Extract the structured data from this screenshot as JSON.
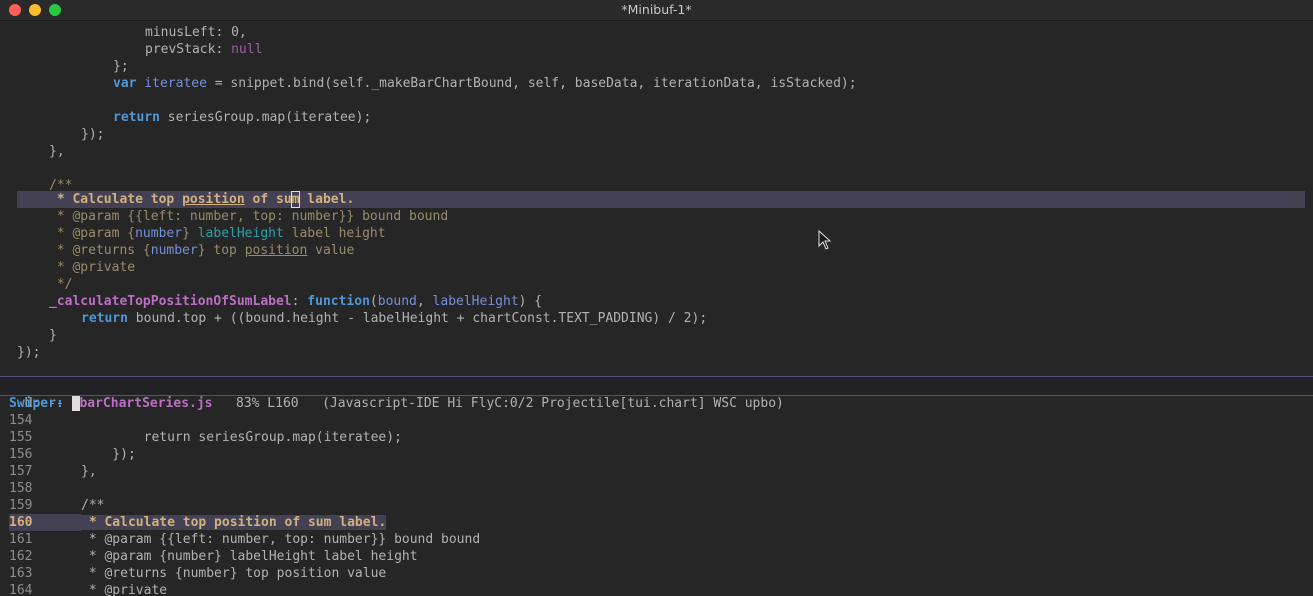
{
  "window": {
    "title": "*Minibuf-1*"
  },
  "editor_lines": [
    {
      "id": "l1",
      "text": "minusLeft: 0,"
    },
    {
      "id": "l2a",
      "text": "prevStack: "
    },
    {
      "id": "l2b",
      "text": "null"
    },
    {
      "id": "l3",
      "text": "};"
    },
    {
      "id": "l4a",
      "text": "var"
    },
    {
      "id": "l4b",
      "text": " iteratee"
    },
    {
      "id": "l4c",
      "text": " = snippet.bind(self._makeBarChartBound, self, baseData, iterationData, isStacked);"
    },
    {
      "id": "l6a",
      "text": "return"
    },
    {
      "id": "l6b",
      "text": " seriesGroup.map(iteratee);"
    },
    {
      "id": "l7",
      "text": "});"
    },
    {
      "id": "l8",
      "text": "},"
    },
    {
      "id": "l10",
      "text": "/**"
    }
  ],
  "doc": {
    "calc_prefix": " * Calculate top ",
    "position": "position",
    "of_su": " of su",
    "m": "m",
    "label": " label.",
    "p1_a": " * @param {{left: number, top: number}} bound bound",
    "p2_a": " * @param {",
    "p2_b": "number",
    "p2_c": "} ",
    "p2_d": "labelHeight",
    "p2_e": " label height",
    "r_a": " * @returns {",
    "r_b": "number",
    "r_c": "} top ",
    "r_d": "position",
    "r_e": " value",
    "priv": " * @private",
    "end": " */"
  },
  "fn_line": {
    "name": "_calculateTopPositionOfSumLabel",
    "colon": ": ",
    "kw": "function",
    "open": "(",
    "p1": "bound",
    "comma": ", ",
    "p2": "labelHeight",
    "close": ") {"
  },
  "ret_line": {
    "kw": "return",
    "rest": " bound.top + ((bound.height - labelHeight + chartConst.TEXT_PADDING) / 2);"
  },
  "closing": {
    "brace": "}",
    "end": "});"
  },
  "modeline": {
    "state": "U:---  ",
    "buffer": "barChartSeries.js",
    "position": "   83% L160   ",
    "modes": "(Javascript-IDE Hi FlyC:0/2 Projectile[tui.chart] WSC upbo)"
  },
  "minibuffer": {
    "prompt": "Swiper:",
    "rows": [
      {
        "num": "154",
        "text": ""
      },
      {
        "num": "155",
        "text": "        return seriesGroup.map(iteratee);"
      },
      {
        "num": "156",
        "text": "    });"
      },
      {
        "num": "157",
        "text": "},"
      },
      {
        "num": "158",
        "text": ""
      },
      {
        "num": "159",
        "text": "/**"
      },
      {
        "num": "160",
        "text": " * Calculate top position of sum label."
      },
      {
        "num": "161",
        "text": " * @param {{left: number, top: number}} bound bound"
      },
      {
        "num": "162",
        "text": " * @param {number} labelHeight label height"
      },
      {
        "num": "163",
        "text": " * @returns {number} top position value"
      },
      {
        "num": "164",
        "text": " * @private"
      }
    ]
  },
  "colors": {
    "background": "#262626",
    "keyword": "#4f97d7",
    "function": "#bc6ec5",
    "highlight": "#444155",
    "doc": "#9a8b6c"
  }
}
